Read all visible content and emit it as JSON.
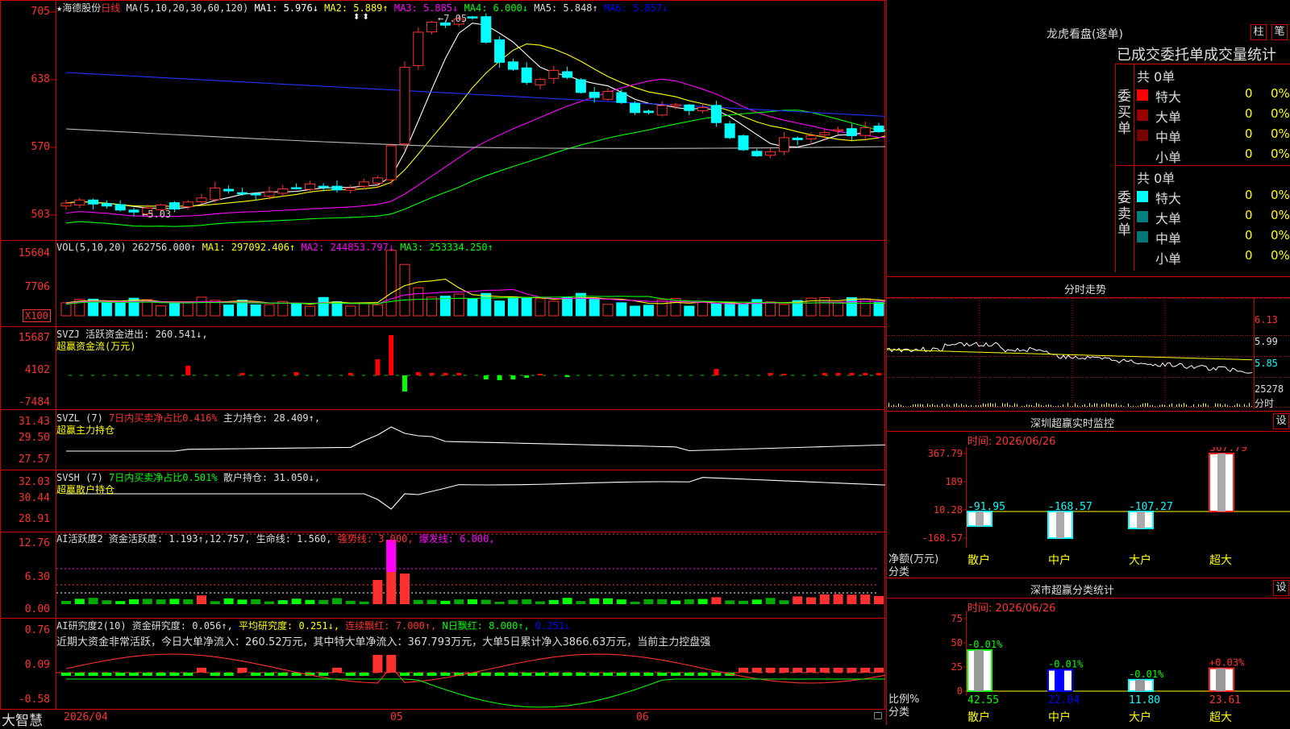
{
  "stock": {
    "star": "★",
    "name": "海德股份",
    "period": "日线"
  },
  "ma_line": [
    {
      "text": "MA(5,10,20,30,60,120)",
      "color": "#dddddd"
    },
    {
      "text": "MA1: 5.976↓",
      "color": "#ffffff"
    },
    {
      "text": "MA2: 5.889↑",
      "color": "#ffff00"
    },
    {
      "text": "MA3: 5.885↓",
      "color": "#ff00ff"
    },
    {
      "text": "MA4: 6.000↓",
      "color": "#00ff00"
    },
    {
      "text": "MA5: 5.848↑",
      "color": "#dddddd"
    },
    {
      "text": "MA6: 5.857↓",
      "color": "#0000ff"
    }
  ],
  "main_axis": [
    "705",
    "638",
    "570",
    "503"
  ],
  "price_notes": {
    "high": "7.05",
    "low": "5.03"
  },
  "vol_line": [
    {
      "text": "VOL(5,10,20) 262756.000↑",
      "color": "#dddddd"
    },
    {
      "text": "MA1: 297092.406↑",
      "color": "#ffff00"
    },
    {
      "text": "MA2: 244853.797↓",
      "color": "#ff00ff"
    },
    {
      "text": "MA3: 253334.250↑",
      "color": "#00ff00"
    }
  ],
  "vol_axis": [
    "15604",
    "7706"
  ],
  "vol_unit": "X100",
  "svzj": {
    "line1": "SVZJ  活跃资金进出: 260.541↓,",
    "line2": "超赢资金流(万元)",
    "axis": [
      "15687",
      "4102",
      "-7484"
    ]
  },
  "svzl": {
    "line1a": "SVZL (7) ",
    "line1b": "7日内买卖净占比0.416%",
    "line1c": " 主力持仓: 28.409↑,",
    "line2": "超赢主力持仓",
    "axis": [
      "31.43",
      "29.50",
      "27.57"
    ]
  },
  "svsh": {
    "line1a": "SVSH (7) ",
    "line1b": "7日内买卖净占比0.501%",
    "line1c": " 散户持仓: 31.050↓,",
    "line2": "超赢散户持仓",
    "axis": [
      "32.03",
      "30.44",
      "28.91"
    ]
  },
  "ai_active": {
    "parts": [
      {
        "text": "AI活跃度2 资金活跃度: 1.193↑,12.757,",
        "color": "#dddddd"
      },
      {
        "text": "生命线: 1.560,",
        "color": "#dddddd"
      },
      {
        "text": "强势线: 3.000,",
        "color": "#ff3030"
      },
      {
        "text": "爆发线: 6.000,",
        "color": "#ff00ff"
      }
    ],
    "axis": [
      "12.76",
      "6.30",
      "0.00"
    ]
  },
  "ai_research": {
    "parts": [
      {
        "text": "AI研究度2(10) 资金研究度: 0.056↑,",
        "color": "#dddddd"
      },
      {
        "text": "平均研究度: 0.251↓,",
        "color": "#ffff00"
      },
      {
        "text": "连续飘红: 7.000↑,",
        "color": "#ff3030"
      },
      {
        "text": "N日飘红: 8.000↑,",
        "color": "#00ff00"
      },
      {
        "text": "0.251↓",
        "color": "#0000ff"
      }
    ],
    "summary": "近期大资金非常活跃，今日大单净流入：260.52万元，其中特大单净流入：367.793万元，大单5日累计净入3866.63万元，当前主力控盘强",
    "axis": [
      "0.76",
      "0.09",
      "-0.58"
    ]
  },
  "bottom": {
    "brand": "大智慧",
    "dates": [
      "2026/04",
      "05",
      "06"
    ]
  },
  "dragon": {
    "title": "龙虎看盘(逐单)",
    "btn1": "柱",
    "btn2": "笔",
    "subtitle": "已成交委托单成交量统计",
    "buy": {
      "label": "委买单",
      "total": "共 0单",
      "rows": [
        {
          "name": "特大",
          "val": "0",
          "pct": "0%",
          "color": "#ff0000"
        },
        {
          "name": "大单",
          "val": "0",
          "pct": "0%",
          "color": "#990000"
        },
        {
          "name": "中单",
          "val": "0",
          "pct": "0%",
          "color": "#770000"
        },
        {
          "name": "小单",
          "val": "0",
          "pct": "0%",
          "color": ""
        }
      ]
    },
    "sell": {
      "label": "委卖单",
      "total": "共 0单",
      "rows": [
        {
          "name": "特大",
          "val": "0",
          "pct": "0%",
          "color": "#00ffff"
        },
        {
          "name": "大单",
          "val": "0",
          "pct": "0%",
          "color": "#008080"
        },
        {
          "name": "中单",
          "val": "0",
          "pct": "0%",
          "color": "#007777"
        },
        {
          "name": "小单",
          "val": "0",
          "pct": "0%",
          "color": ""
        }
      ]
    }
  },
  "intraday": {
    "title": "分时走势",
    "axis": [
      "6.13",
      "5.99",
      "5.85",
      "25278",
      "分时"
    ]
  },
  "monitor": {
    "title": "深圳超赢实时监控",
    "btn": "设",
    "time": "时间: 2026/06/26",
    "axis": [
      "367.79",
      "189",
      "10.28",
      "-168.57"
    ],
    "ylabel1": "净额(万元)",
    "ylabel2": "分类",
    "bars": [
      {
        "cat": "散户",
        "value": -91.95,
        "label": "-91.95"
      },
      {
        "cat": "中户",
        "value": -168.57,
        "label": "-168.57"
      },
      {
        "cat": "大户",
        "value": -107.27,
        "label": "-107.27"
      },
      {
        "cat": "超大",
        "value": 367.79,
        "label": "367.79"
      }
    ]
  },
  "classify": {
    "title": "深市超赢分类统计",
    "btn": "设",
    "time": "时间: 2026/06/26",
    "axis": [
      "75",
      "50",
      "25",
      "0"
    ],
    "ylabel1": "比例%",
    "ylabel2": "分类",
    "bars": [
      {
        "cat": "散户",
        "pct": 42.55,
        "label": "42.55",
        "chg": "-0.01%"
      },
      {
        "cat": "中户",
        "pct": 22.04,
        "label": "22.04",
        "chg": "-0.01%"
      },
      {
        "cat": "大户",
        "pct": 11.8,
        "label": "11.80",
        "chg": "-0.01%"
      },
      {
        "cat": "超大",
        "pct": 23.61,
        "label": "23.61",
        "chg": "+0.03%"
      }
    ]
  }
}
